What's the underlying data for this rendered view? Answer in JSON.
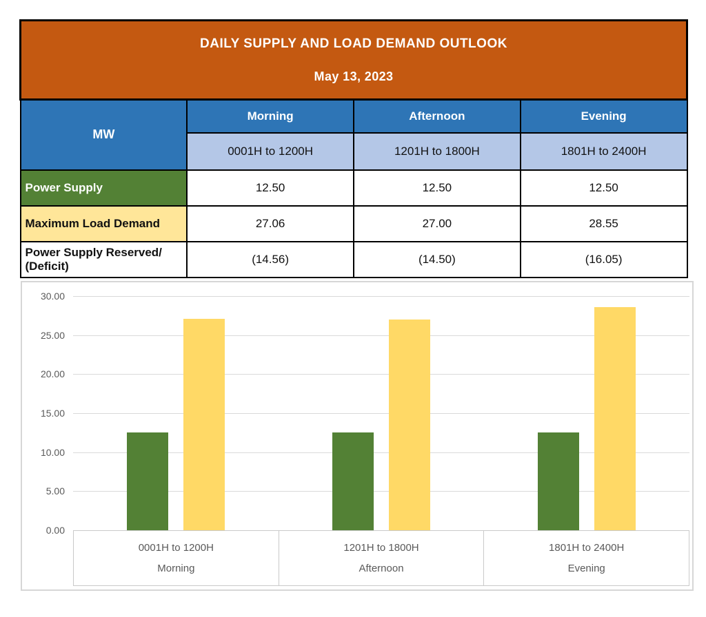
{
  "table": {
    "title": "DAILY SUPPLY AND LOAD DEMAND OUTLOOK",
    "date": "May 13, 2023",
    "unit_header": "MW",
    "columns": [
      {
        "label": "Morning",
        "sub": "0001H to 1200H"
      },
      {
        "label": "Afternoon",
        "sub": "1201H to 1800H"
      },
      {
        "label": "Evening",
        "sub": "1801H to 2400H"
      }
    ],
    "rows": [
      {
        "label": "Power Supply",
        "values": [
          "12.50",
          "12.50",
          "12.50"
        ]
      },
      {
        "label": "Maximum Load Demand",
        "values": [
          "27.06",
          "27.00",
          "28.55"
        ]
      },
      {
        "label": "Power Supply Reserved/ (Deficit)",
        "values": [
          "(14.56)",
          "(14.50)",
          "(16.05)"
        ]
      }
    ]
  },
  "colors": {
    "title_bg": "#C45911",
    "header_bg": "#2E75B6",
    "subheader_bg": "#B4C7E7",
    "supply_row_bg": "#538135",
    "demand_row_bg": "#FFE699",
    "bar_green": "#538135",
    "bar_yellow": "#FFD966",
    "grid_gray": "#D9D9D9",
    "axis_text_gray": "#595959"
  },
  "chart_data": {
    "type": "bar",
    "categories": [
      "0001H to 1200H",
      "1201H to 1800H",
      "1801H to 2400H"
    ],
    "category_sublabels": [
      "Morning",
      "Afternoon",
      "Evening"
    ],
    "series": [
      {
        "name": "Power Supply",
        "color": "#538135",
        "values": [
          12.5,
          12.5,
          12.5
        ]
      },
      {
        "name": "Maximum Load Demand",
        "color": "#FFD966",
        "values": [
          27.06,
          27.0,
          28.55
        ]
      }
    ],
    "title": "",
    "xlabel": "",
    "ylabel": "",
    "ylim": [
      0,
      30
    ],
    "ytick_step": 5,
    "ytick_labels": [
      "0.00",
      "5.00",
      "10.00",
      "15.00",
      "20.00",
      "25.00",
      "30.00"
    ],
    "grid": true,
    "legend_position": "none"
  }
}
